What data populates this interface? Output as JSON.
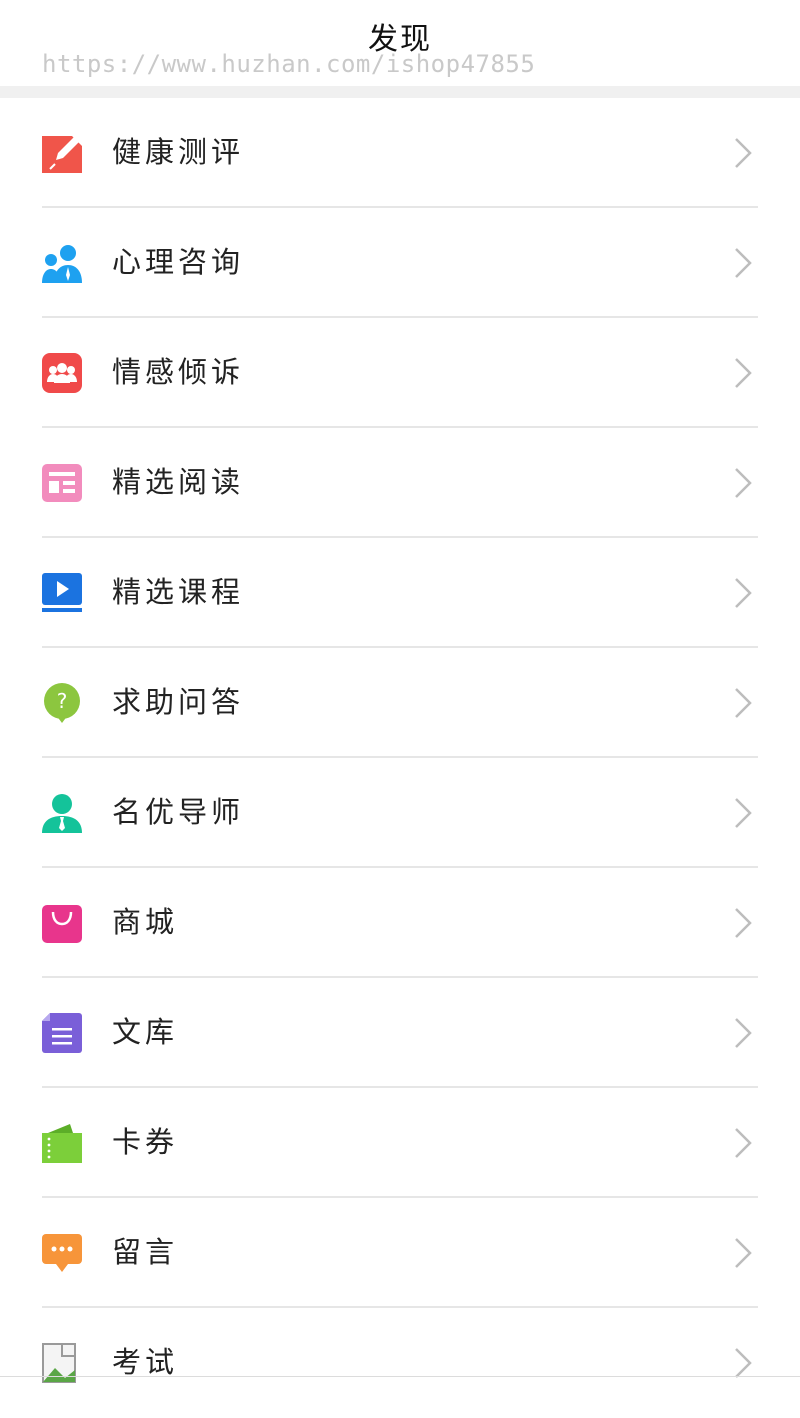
{
  "header": {
    "title": "发现",
    "watermark": "https://www.huzhan.com/ishop47855"
  },
  "menu": {
    "items": [
      {
        "label": "健康测评",
        "icon": "edit-icon",
        "color": "#f0554a"
      },
      {
        "label": "心理咨询",
        "icon": "consultants-icon",
        "color": "#1ea1f0"
      },
      {
        "label": "情感倾诉",
        "icon": "group-icon",
        "color": "#f04a4a"
      },
      {
        "label": "精选阅读",
        "icon": "article-icon",
        "color": "#f28cbd"
      },
      {
        "label": "精选课程",
        "icon": "video-play-icon",
        "color": "#1b73e0"
      },
      {
        "label": "求助问答",
        "icon": "question-bubble-icon",
        "color": "#8cc63f"
      },
      {
        "label": "名优导师",
        "icon": "teacher-icon",
        "color": "#14c39a"
      },
      {
        "label": "商城",
        "icon": "shopping-bag-icon",
        "color": "#e8358c"
      },
      {
        "label": "文库",
        "icon": "document-icon",
        "color": "#7a5fd8"
      },
      {
        "label": "卡券",
        "icon": "coupon-icon",
        "color": "#7ccf3a"
      },
      {
        "label": "留言",
        "icon": "message-icon",
        "color": "#f7953a"
      },
      {
        "label": "考试",
        "icon": "broken-image-icon",
        "color": "#9a9a9a"
      }
    ]
  }
}
